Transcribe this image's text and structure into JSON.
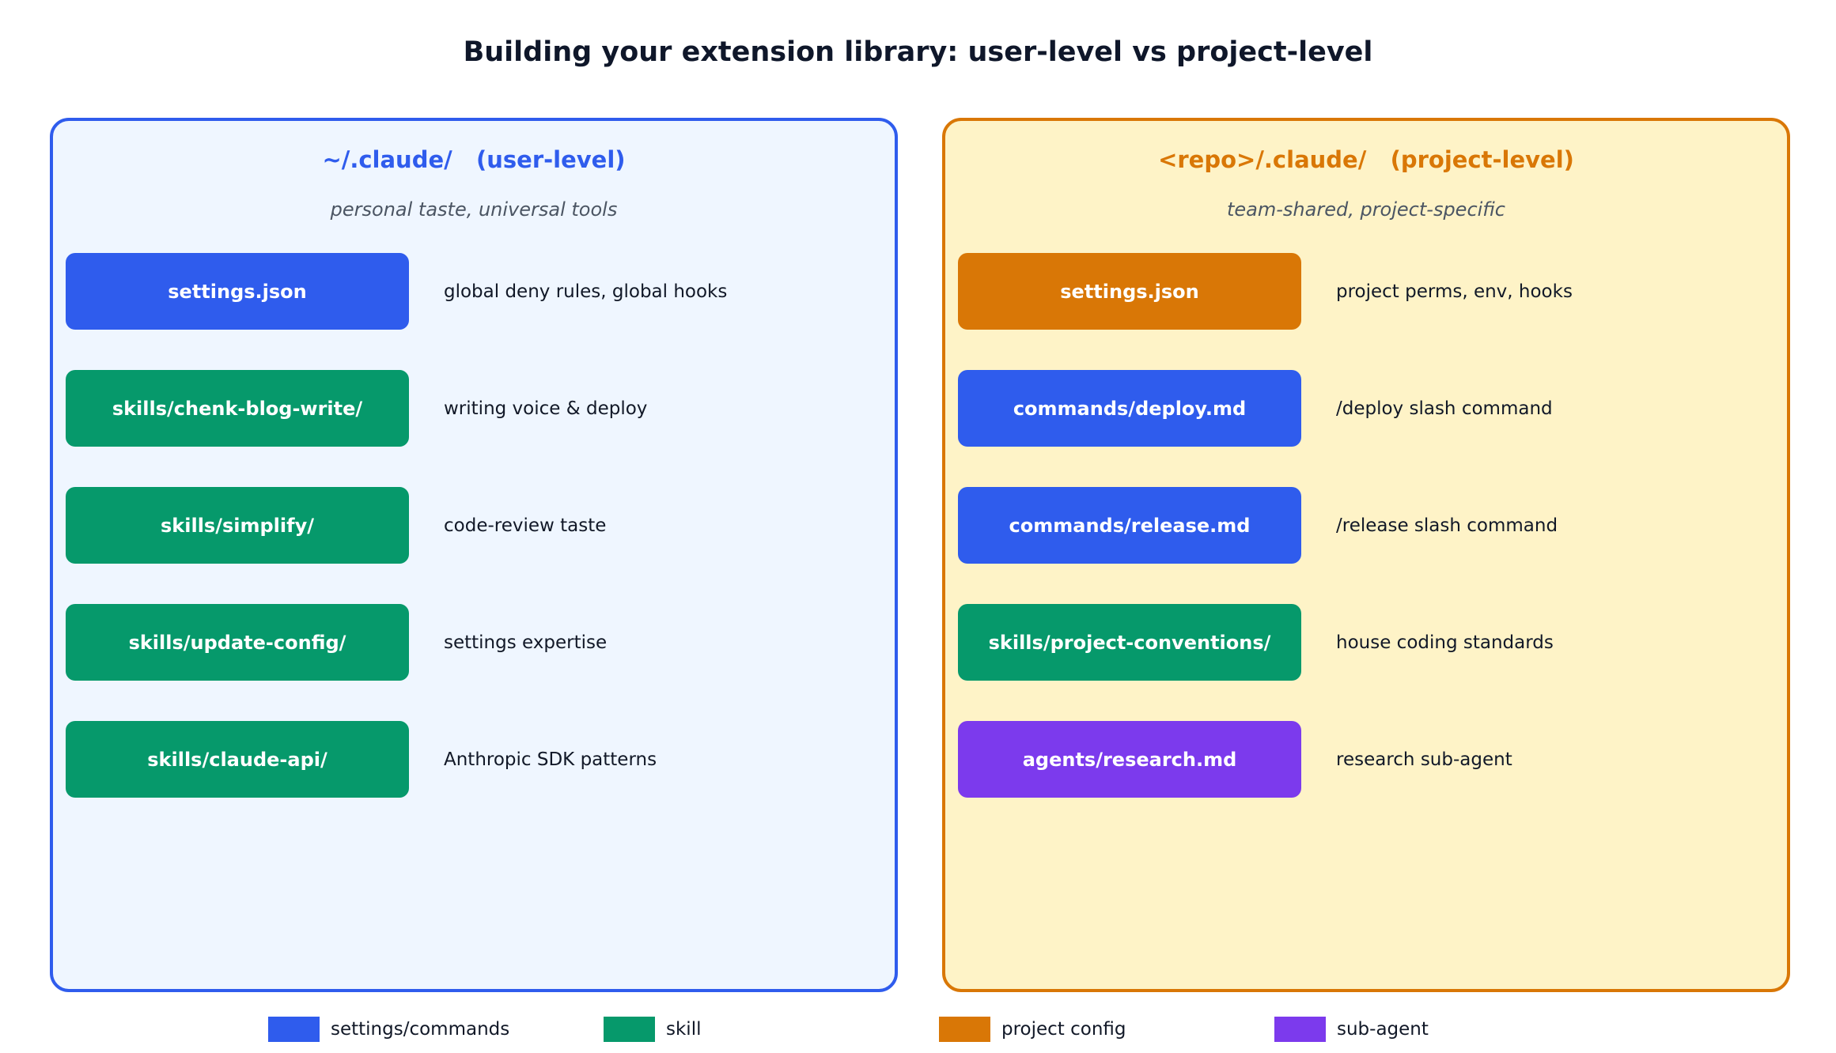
{
  "title": "Building your extension library: user-level vs project-level",
  "colors": {
    "settings_commands": "#2f5ced",
    "skill": "#06996b",
    "project_config": "#d97706",
    "sub_agent": "#7c3aed",
    "user_panel_bg": "#eff6ff",
    "project_panel_bg": "#fef3c7"
  },
  "panels": {
    "user": {
      "heading": "~/.claude/   (user-level)",
      "subtitle": "personal taste, universal tools",
      "items": [
        {
          "label": "settings.json",
          "description": "global deny rules, global hooks",
          "kind": "settings_commands"
        },
        {
          "label": "skills/chenk-blog-write/",
          "description": "writing voice & deploy",
          "kind": "skill"
        },
        {
          "label": "skills/simplify/",
          "description": "code-review taste",
          "kind": "skill"
        },
        {
          "label": "skills/update-config/",
          "description": "settings expertise",
          "kind": "skill"
        },
        {
          "label": "skills/claude-api/",
          "description": "Anthropic SDK patterns",
          "kind": "skill"
        }
      ]
    },
    "project": {
      "heading": "<repo>/.claude/   (project-level)",
      "subtitle": "team-shared, project-specific",
      "items": [
        {
          "label": "settings.json",
          "description": "project perms, env, hooks",
          "kind": "project_config"
        },
        {
          "label": "commands/deploy.md",
          "description": "/deploy slash command",
          "kind": "settings_commands"
        },
        {
          "label": "commands/release.md",
          "description": "/release slash command",
          "kind": "settings_commands"
        },
        {
          "label": "skills/project-conventions/",
          "description": "house coding standards",
          "kind": "skill"
        },
        {
          "label": "agents/research.md",
          "description": "research sub-agent",
          "kind": "sub_agent"
        }
      ]
    }
  },
  "legend": [
    {
      "label": "settings/commands",
      "kind": "settings_commands"
    },
    {
      "label": "skill",
      "kind": "skill"
    },
    {
      "label": "project config",
      "kind": "project_config"
    },
    {
      "label": "sub-agent",
      "kind": "sub_agent"
    }
  ]
}
